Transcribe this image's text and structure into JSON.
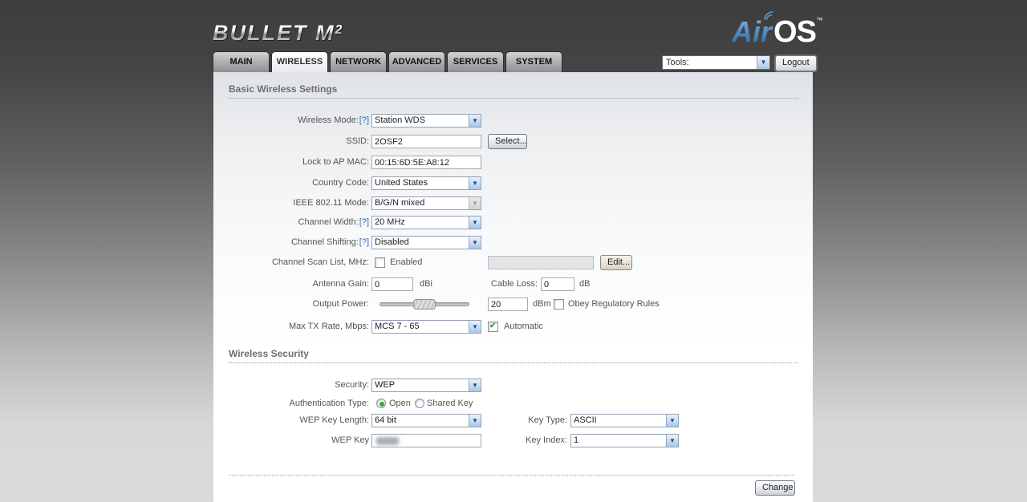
{
  "header": {
    "device_logo": {
      "name": "BULLET M",
      "model_sup": "2"
    },
    "airos": {
      "air": "Air",
      "os": "OS",
      "tm": "™"
    },
    "tools_select": {
      "value": "Tools:"
    },
    "logout_label": "Logout"
  },
  "tabs": [
    {
      "label": "MAIN",
      "active": false
    },
    {
      "label": "WIRELESS",
      "active": true
    },
    {
      "label": "NETWORK",
      "active": false
    },
    {
      "label": "ADVANCED",
      "active": false
    },
    {
      "label": "SERVICES",
      "active": false
    },
    {
      "label": "SYSTEM",
      "active": false
    }
  ],
  "basic_wireless": {
    "title": "Basic Wireless Settings",
    "wireless_mode": {
      "label": "Wireless Mode:",
      "help": "[?]",
      "value": "Station WDS"
    },
    "ssid": {
      "label": "SSID:",
      "value": "2OSF2",
      "select_button": "Select..."
    },
    "lock_to_ap_mac": {
      "label": "Lock to AP MAC:",
      "value": "00:15:6D:5E:A8:12"
    },
    "country_code": {
      "label": "Country Code:",
      "value": "United States"
    },
    "ieee_mode": {
      "label": "IEEE 802.11 Mode:",
      "value": "B/G/N mixed",
      "disabled": true
    },
    "channel_width": {
      "label": "Channel Width:",
      "help": "[?]",
      "value": "20 MHz"
    },
    "channel_shifting": {
      "label": "Channel Shifting:",
      "help": "[?]",
      "value": "Disabled"
    },
    "channel_scan": {
      "label": "Channel Scan List, MHz:",
      "checkbox_label": "Enabled",
      "checked": false,
      "list_value": "",
      "edit_button": "Edit..."
    },
    "antenna_gain": {
      "label": "Antenna Gain:",
      "value": "0",
      "unit": "dBi"
    },
    "cable_loss": {
      "label": "Cable Loss:",
      "value": "0",
      "unit": "dB"
    },
    "output_power": {
      "label": "Output Power:",
      "value": "20",
      "unit": "dBm",
      "checkbox_label": "Obey Regulatory Rules",
      "checked": false
    },
    "max_tx_rate": {
      "label": "Max TX Rate, Mbps:",
      "value": "MCS 7 - 65",
      "checkbox_label": "Automatic",
      "checked": true
    }
  },
  "wireless_security": {
    "title": "Wireless Security",
    "security": {
      "label": "Security:",
      "value": "WEP"
    },
    "auth_type": {
      "label": "Authentication Type:",
      "options": [
        "Open",
        "Shared Key"
      ],
      "selected": "Open"
    },
    "wep_key_length": {
      "label": "WEP Key Length:",
      "value": "64 bit"
    },
    "key_type": {
      "label": "Key Type:",
      "value": "ASCII"
    },
    "wep_key": {
      "label": "WEP Key",
      "value_redacted": true
    },
    "key_index": {
      "label": "Key Index:",
      "value": "1"
    }
  },
  "footer": {
    "change_button": "Change"
  },
  "colors": {
    "help_link_blue": "#2d6cb4",
    "check_green": "#2fa32a",
    "airos_blue": "#5590c2"
  }
}
